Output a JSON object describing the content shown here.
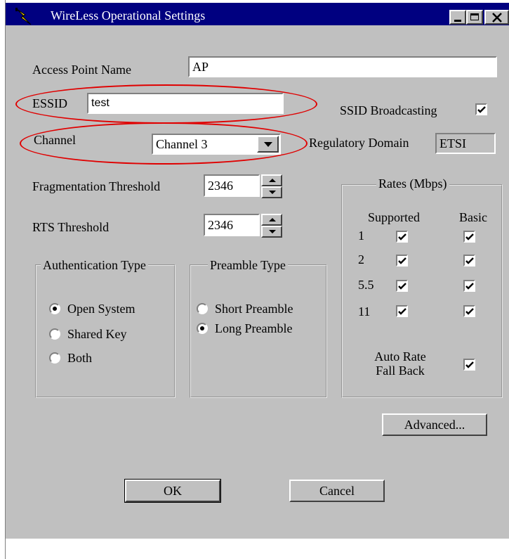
{
  "window": {
    "title": "WireLess Operational Settings",
    "title_icon": "lightning-bolt-icon",
    "controls": [
      "minimize-icon",
      "maximize-icon",
      "close-icon"
    ]
  },
  "fields": {
    "ap_name_label": "Access Point Name",
    "ap_name_value": "AP",
    "essid_label": "ESSID",
    "essid_value": "test",
    "ssid_broadcasting_label": "SSID Broadcasting",
    "ssid_broadcasting_checked": true,
    "channel_label": "Channel",
    "channel_value": "Channel 3",
    "regulatory_label": "Regulatory Domain",
    "regulatory_value": "ETSI",
    "frag_label": "Fragmentation Threshold",
    "frag_value": "2346",
    "rts_label": "RTS Threshold",
    "rts_value": "2346"
  },
  "auth": {
    "title": "Authentication Type",
    "options": [
      "Open System",
      "Shared Key",
      "Both"
    ],
    "selected": "Open System"
  },
  "preamble": {
    "title": "Preamble Type",
    "options": [
      "Short Preamble",
      "Long Preamble"
    ],
    "selected": "Long Preamble"
  },
  "rates": {
    "title": "Rates (Mbps)",
    "col_supported": "Supported",
    "col_basic": "Basic",
    "rows": [
      {
        "rate": "1",
        "supported": true,
        "basic": true
      },
      {
        "rate": "2",
        "supported": true,
        "basic": true
      },
      {
        "rate": "5.5",
        "supported": true,
        "basic": true
      },
      {
        "rate": "11",
        "supported": true,
        "basic": true
      }
    ],
    "auto_fallback_line1": "Auto Rate",
    "auto_fallback_line2": "Fall Back",
    "auto_fallback_checked": true
  },
  "buttons": {
    "advanced": "Advanced...",
    "ok": "OK",
    "cancel": "Cancel"
  },
  "colors": {
    "titlebar": "#000080",
    "face": "#c0c0c0",
    "highlight_ellipse": "#e00000"
  }
}
